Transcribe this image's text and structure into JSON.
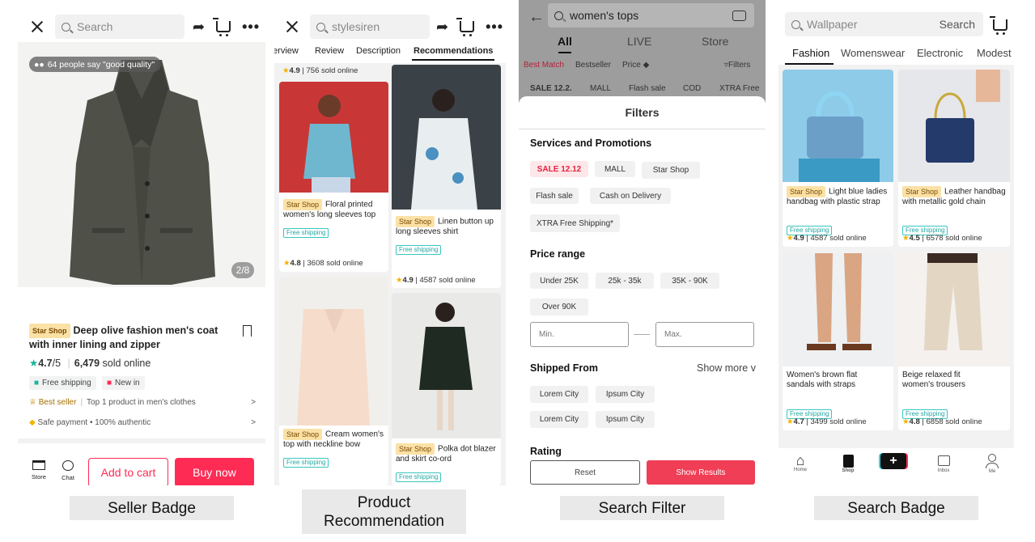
{
  "captions": {
    "p1": "Seller Badge",
    "p2": "Product\nRecommendation",
    "p3": "Search Filter",
    "p4": "Search Badge"
  },
  "p1": {
    "search_placeholder": "Search",
    "social_proof": "64 people say \"good quality\"",
    "image_counter": "2/8",
    "shop_tag": "Star Shop",
    "title": "Deep olive fashion men's coat with inner lining and zipper",
    "rating": "4.7",
    "rating_suffix": "/5",
    "sold_count": "6,479",
    "sold_label": "sold online",
    "free_shipping": "Free shipping",
    "new_in": "New in",
    "best_seller": "Best seller",
    "best_seller_detail": "Top 1 product in men's clothes",
    "safe_payment": "Safe payment",
    "authentic": "100% authentic",
    "store_label": "Store",
    "chat_label": "Chat",
    "add_to_cart": "Add to cart",
    "buy_now": "Buy now",
    "colors": {
      "accent": "#fe2c55",
      "coat": "#4d4e45"
    }
  },
  "p2": {
    "search_value": "stylesiren",
    "tabs": [
      "Overview",
      "Review",
      "Description",
      "Recommendations"
    ],
    "active_tab": "Recommendations",
    "top_rating": "4.9",
    "top_sold": "756 sold online",
    "items": [
      {
        "tag": "Star Shop",
        "name": "Floral printed women's long sleeves top",
        "free": "Free shipping",
        "rating": "4.8",
        "sold": "3608 sold online"
      },
      {
        "tag": "Star Shop",
        "name": "Linen button up long sleeves shirt",
        "free": "Free shipping",
        "rating": "4.9",
        "sold": "4587 sold online"
      },
      {
        "tag": "Star Shop",
        "name": "Cream women's top with neckline bow",
        "free": "Free shipping"
      },
      {
        "tag": "Star Shop",
        "name": "Polka dot blazer and skirt co-ord",
        "free": "Free shipping"
      }
    ]
  },
  "p3": {
    "search_value": "women's tops",
    "tabs": [
      "All",
      "LIVE",
      "Store"
    ],
    "sort": [
      "Best Match",
      "Bestseller",
      "Price"
    ],
    "filters_label": "Filters",
    "quick": [
      "SALE 12.2.",
      "MALL",
      "Flash sale",
      "COD",
      "XTRA Free"
    ],
    "sheet_title": "Filters",
    "services_heading": "Services and Promotions",
    "services": [
      "SALE 12.12",
      "MALL",
      "Star Shop",
      "Flash sale",
      "Cash on Delivery",
      "XTRA Free Shipping*"
    ],
    "price_heading": "Price range",
    "prices": [
      "Under 25K",
      "25k - 35k",
      "35K - 90K",
      "Over 90K"
    ],
    "min_placeholder": "Min.",
    "max_placeholder": "Max.",
    "shipped_heading": "Shipped From",
    "show_more": "Show more",
    "cities": [
      "Lorem City",
      "Ipsum City",
      "Lorem City",
      "Ipsum City"
    ],
    "rating_heading": "Rating",
    "reset": "Reset",
    "show_results": "Show Results"
  },
  "p4": {
    "search_placeholder": "Wallpaper",
    "search_button": "Search",
    "tabs": [
      "Fashion",
      "Womenswear",
      "Electronic",
      "Modest"
    ],
    "active_tab": "Fashion",
    "items": [
      {
        "tag": "Star Shop",
        "name": "Light blue ladies handbag with plastic strap",
        "free": "Free shipping",
        "rating": "4.9",
        "sold": "4587 sold online"
      },
      {
        "tag": "Star Shop",
        "name": "Leather handbag with metallic gold chain",
        "free": "Free shipping",
        "rating": "4.5",
        "sold": "6578 sold online"
      },
      {
        "tag": "",
        "name": "Women's brown flat sandals with straps",
        "free": "Free shipping",
        "rating": "4.7",
        "sold": "3499 sold online"
      },
      {
        "tag": "",
        "name": "Beige relaxed fit women's trousers",
        "free": "Free shipping",
        "rating": "4.8",
        "sold": "6858 sold online"
      }
    ],
    "nav": [
      "Home",
      "Shop",
      "",
      "Inbox",
      "Me"
    ]
  }
}
